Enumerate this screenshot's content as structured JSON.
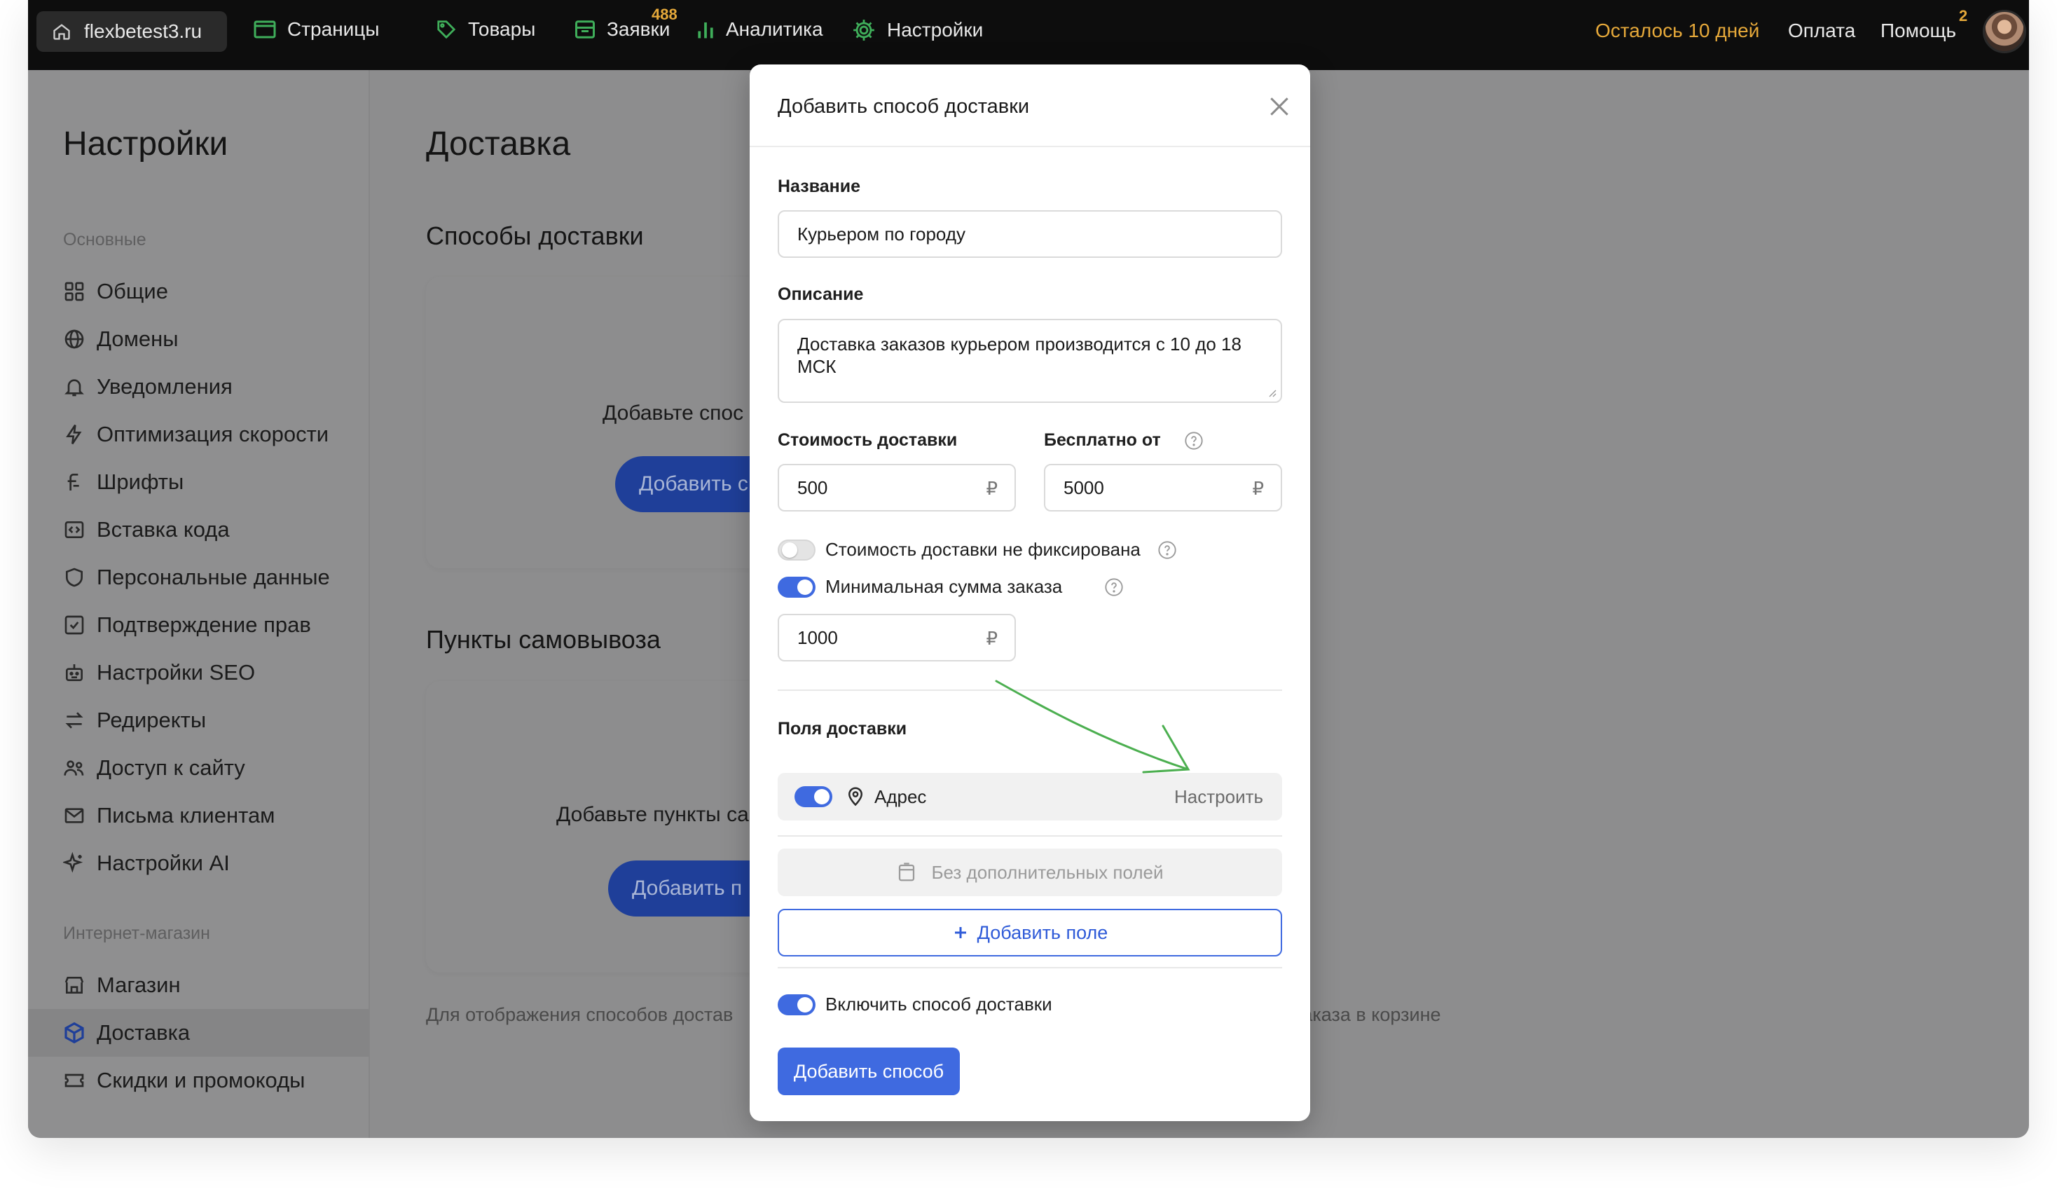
{
  "topbar": {
    "site": "flexbetest3.ru",
    "nav": [
      {
        "label": "Страницы",
        "icon": "pages-icon"
      },
      {
        "label": "Товары",
        "icon": "tag-icon"
      },
      {
        "label": "Заявки",
        "icon": "inbox-icon",
        "badge": "488"
      },
      {
        "label": "Аналитика",
        "icon": "chart-icon"
      },
      {
        "label": "Настройки",
        "icon": "gear-icon"
      }
    ],
    "trial": "Осталось 10 дней",
    "payment": "Оплата",
    "help": "Помощь",
    "help_badge": "2",
    "colors": {
      "accent": "#e6a93a",
      "nav_icon": "#3fae5a"
    }
  },
  "sidebar": {
    "title": "Настройки",
    "group_basic": "Основные",
    "items_basic": [
      {
        "label": "Общие",
        "icon": "grid-icon"
      },
      {
        "label": "Домены",
        "icon": "globe-icon"
      },
      {
        "label": "Уведомления",
        "icon": "bell-icon"
      },
      {
        "label": "Оптимизация скорости",
        "icon": "lightning-icon"
      },
      {
        "label": "Шрифты",
        "icon": "font-icon"
      },
      {
        "label": "Вставка кода",
        "icon": "code-icon"
      },
      {
        "label": "Персональные данные",
        "icon": "shield-icon"
      },
      {
        "label": "Подтверждение прав",
        "icon": "checkbox-icon"
      },
      {
        "label": "Настройки SEO",
        "icon": "robot-icon"
      },
      {
        "label": "Редиректы",
        "icon": "redirect-icon"
      },
      {
        "label": "Доступ к сайту",
        "icon": "users-icon"
      },
      {
        "label": "Письма клиентам",
        "icon": "mail-icon"
      },
      {
        "label": "Настройки AI",
        "icon": "sparkle-icon"
      }
    ],
    "group_shop": "Интернет-магазин",
    "items_shop": [
      {
        "label": "Магазин",
        "icon": "shop-icon"
      },
      {
        "label": "Доставка",
        "icon": "box-icon",
        "active": true
      },
      {
        "label": "Скидки и промокоды",
        "icon": "coupon-icon"
      }
    ]
  },
  "main": {
    "title": "Доставка",
    "methods_title": "Способы доставки",
    "methods_empty": "Добавьте спос",
    "methods_button": "Добавить с",
    "pickup_title": "Пункты самовывоза",
    "pickup_empty": "Добавьте пункты са",
    "pickup_button": "Добавить п",
    "footnote_left": "Для отображения способов достав",
    "footnote_right": "заказа в корзине"
  },
  "modal": {
    "title": "Добавить способ доставки",
    "name_label": "Название",
    "name_value": "Курьером по городу",
    "desc_label": "Описание",
    "desc_value": "Доставка заказов курьером производится с 10 до 18 МСК",
    "cost_label": "Стоимость доставки",
    "cost_value": "500",
    "free_label": "Бесплатно от",
    "free_value": "5000",
    "currency": "₽",
    "not_fixed_label": "Стоимость доставки не фиксирована",
    "not_fixed_on": false,
    "min_sum_label": "Минимальная сумма заказа",
    "min_sum_on": true,
    "min_sum_value": "1000",
    "fields_label": "Поля доставки",
    "address_field": "Адрес",
    "address_on": true,
    "configure": "Настроить",
    "no_extra": "Без дополнительных полей",
    "add_field": "Добавить поле",
    "enable_label": "Включить способ доставки",
    "enable_on": true,
    "submit": "Добавить способ",
    "colors": {
      "primary": "#3f6ae0",
      "arrow": "#4caf50"
    }
  }
}
